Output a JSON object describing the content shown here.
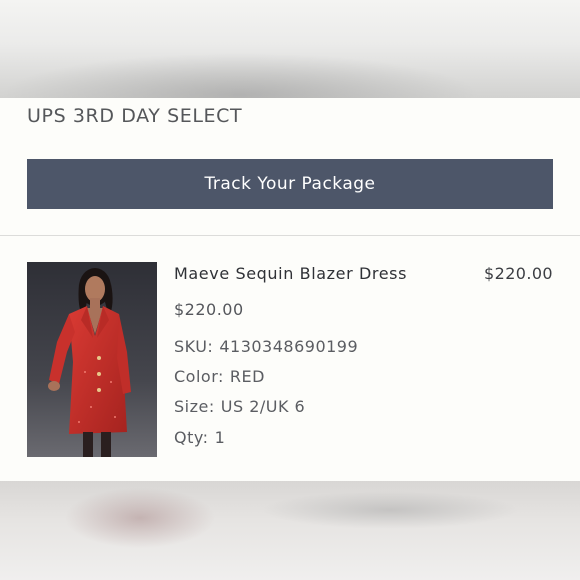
{
  "order": {
    "shipping_method": "UPS 3RD DAY SELECT",
    "track_button_label": "Track Your Package"
  },
  "item": {
    "name": "Maeve Sequin Blazer Dress",
    "line_total": "$220.00",
    "price": "$220.00",
    "sku_label": "SKU:",
    "sku": "4130348690199",
    "color_label": "Color:",
    "color": "RED",
    "size_label": "Size:",
    "size": "US 2/UK 6",
    "qty_label": "Qty:",
    "qty": "1",
    "image_description_name": "product-photo"
  },
  "colors": {
    "button_bg": "#4d5669",
    "card_bg": "#fdfdfa",
    "dress_red": "#c8312c"
  }
}
